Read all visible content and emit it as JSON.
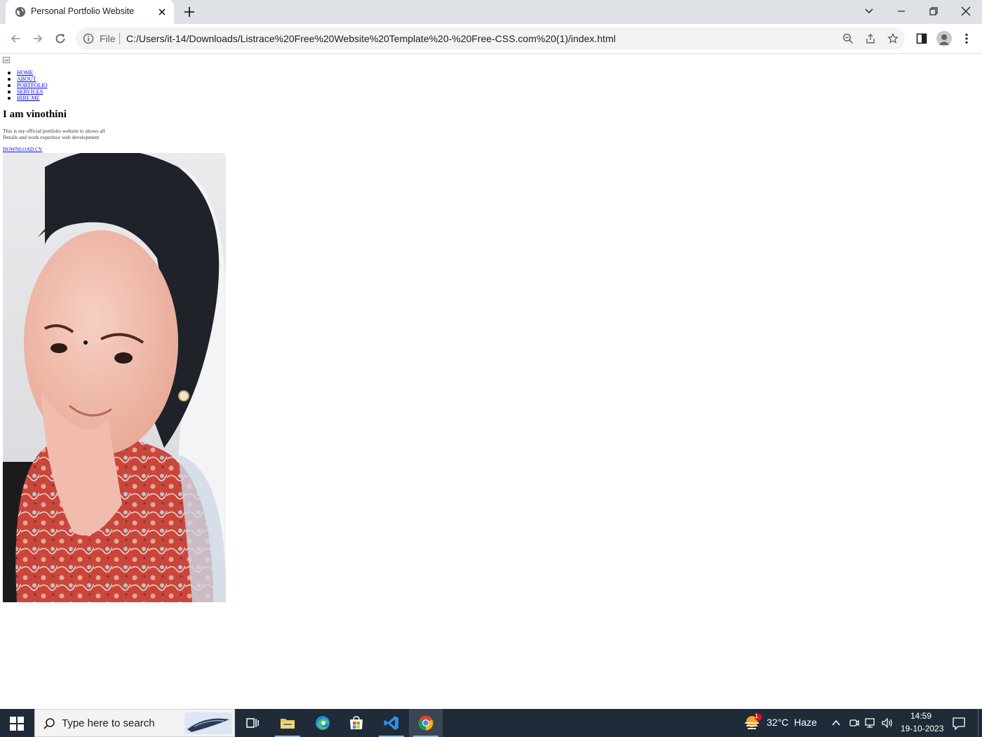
{
  "browser": {
    "tab": {
      "title": "Personal Portfolio Website"
    },
    "address": {
      "scheme_label": "File",
      "url": "C:/Users/it-14/Downloads/Listrace%20Free%20Website%20Template%20-%20Free-CSS.com%20(1)/index.html"
    }
  },
  "page": {
    "nav": [
      "HOME",
      "ABOUT",
      "PORTFOLIO",
      "SERVICES",
      "HIRE ME"
    ],
    "hero": {
      "title": "I am vinothini",
      "description_line1": "This is my official portfolio website to shows all",
      "description_line2": "Details and work experince web development",
      "cta": "DOWNLOAD CV"
    }
  },
  "taskbar": {
    "search_placeholder": "Type here to search",
    "weather": {
      "temp": "32°C",
      "condition": "Haze",
      "badge": "1"
    },
    "clock": {
      "time": "14:59",
      "date": "19-10-2023"
    }
  }
}
